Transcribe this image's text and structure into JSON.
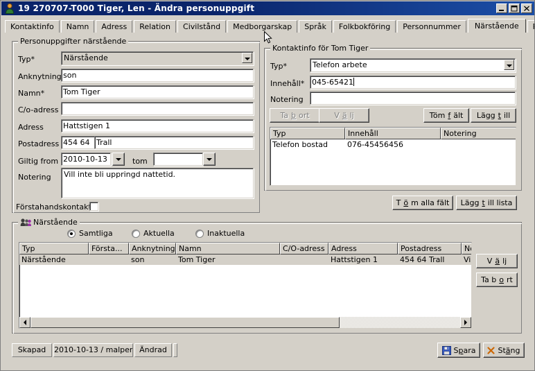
{
  "window": {
    "title": "19 270707-T000   Tiger, Len   -   Ändra personuppgift",
    "icon": "person-icon",
    "minimize_label": "_",
    "maximize_label": "□",
    "close_label": "✕"
  },
  "tabs": [
    {
      "label": "Kontaktinfo",
      "active": false
    },
    {
      "label": "Namn",
      "active": false
    },
    {
      "label": "Adress",
      "active": false
    },
    {
      "label": "Relation",
      "active": false
    },
    {
      "label": "Civilstånd",
      "active": false
    },
    {
      "label": "Medborgarskap",
      "active": false
    },
    {
      "label": "Språk",
      "active": false
    },
    {
      "label": "Folkbokföring",
      "active": false
    },
    {
      "label": "Personnummer",
      "active": false
    },
    {
      "label": "Närstående",
      "active": true
    },
    {
      "label": "Referensperson",
      "active": false
    }
  ],
  "person_group": {
    "title": "Personuppgifter närstående",
    "fields": {
      "typ_label": "Typ*",
      "typ_value": "Närstående",
      "anknytning_label": "Anknytning",
      "anknytning_value": "son",
      "namn_label": "Namn*",
      "namn_value": "Tom Tiger",
      "co_label": "C/o-adress",
      "co_value": "",
      "adress_label": "Adress",
      "adress_value": "Hattstigen 1",
      "postadress_label": "Postadress",
      "postnr_value": "454 64",
      "postort_value": "Trall",
      "giltig_label": "Giltig from",
      "giltig_value": "2010-10-13",
      "tom_label": "tom",
      "tom_value": "",
      "notering_label": "Notering",
      "notering_value": "Vill inte bli uppringd nattetid.",
      "forstahand_label": "Förstahandskontakt",
      "forstahand_checked": false
    }
  },
  "contact_group": {
    "title": "Kontaktinfo för Tom Tiger",
    "typ_label": "Typ*",
    "typ_value": "Telefon arbete",
    "innehall_label": "Innehåll*",
    "innehall_value": "045-65421",
    "notering_label": "Notering",
    "notering_value": "",
    "buttons": [
      {
        "name": "ta-bort-button",
        "label": "Ta ",
        "mnemonic": "b",
        "rest": "ort",
        "disabled": true
      },
      {
        "name": "valj-button",
        "label": "V",
        "mnemonic": "ä",
        "rest": "lj",
        "disabled": true
      },
      {
        "name": "tom-falt-button",
        "label": "Töm ",
        "mnemonic": "f",
        "rest": "ält",
        "disabled": false
      },
      {
        "name": "lagg-till-button",
        "label": "Lägg ",
        "mnemonic": "t",
        "rest": "ill",
        "disabled": false
      }
    ],
    "table": {
      "columns": [
        "Typ",
        "Innehåll",
        "Notering"
      ],
      "rows": [
        {
          "typ": "Telefon bostad",
          "innehall": "076-45456456",
          "notering": ""
        }
      ]
    }
  },
  "mid_buttons": [
    {
      "name": "tom-alla-falt-button",
      "pre": "T",
      "mnemonic": "ö",
      "post": "m alla fält"
    },
    {
      "name": "lagg-till-lista-button",
      "pre": "Lägg ",
      "mnemonic": "t",
      "post": "ill lista"
    }
  ],
  "narstaende_group": {
    "title": "Närstående",
    "icon": "people-icon",
    "filters": [
      {
        "label": "Samtliga",
        "selected": true
      },
      {
        "label": "Aktuella",
        "selected": false
      },
      {
        "label": "Inaktuella",
        "selected": false
      }
    ],
    "table": {
      "columns": [
        "Typ",
        "Första...",
        "Anknytning",
        "Namn",
        "C/O-adress",
        "Adress",
        "Postadress",
        "Noter"
      ],
      "rows": [
        {
          "typ": "Närstående",
          "forsta": "",
          "anknytning": "son",
          "namn": "Tom Tiger",
          "co_adress": "",
          "adress": "Hattstigen 1",
          "postadress": "454 64 Trall",
          "notering": "Vill int"
        }
      ]
    },
    "side_buttons": [
      {
        "name": "grid-valj-button",
        "pre": "V",
        "mnemonic": "ä",
        "post": "lj"
      },
      {
        "name": "grid-ta-bort-button",
        "pre": "Ta b",
        "mnemonic": "o",
        "post": "rt"
      }
    ]
  },
  "statusbar": {
    "skapad_label": "Skapad",
    "skapad_value": "2010-10-13 / malper",
    "andrad_label": "Ändrad",
    "andrad_value": ""
  },
  "footer_buttons": {
    "spara": {
      "pre": "S",
      "mnemonic": "p",
      "post": "ara",
      "icon": "save-floppy-icon"
    },
    "stang": {
      "pre": "St",
      "mnemonic": "ä",
      "post": "ng",
      "icon": "close-x-icon"
    }
  },
  "colors": {
    "titlebar_start": "#0a246a",
    "titlebar_end": "#1c4fa8",
    "face": "#d4d0c8",
    "field": "#ffffff",
    "save_icon": "#3a5fcd",
    "close_icon": "#cc6600"
  }
}
